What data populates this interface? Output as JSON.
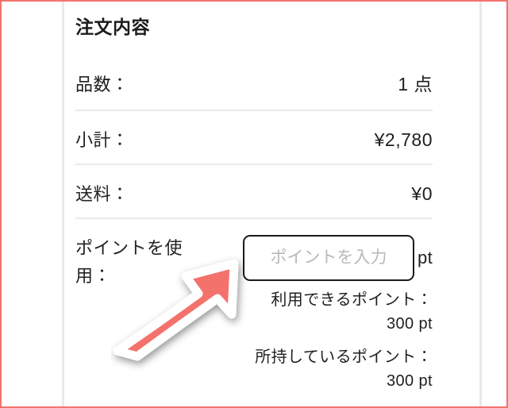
{
  "panel": {
    "title": "注文内容",
    "rows": [
      {
        "label": "品数：",
        "value": "1 点"
      },
      {
        "label": "小計：",
        "value": "¥2,780"
      },
      {
        "label": "送料：",
        "value": "¥0"
      }
    ],
    "points": {
      "label": "ポイントを使用：",
      "input_placeholder": "ポイントを入力",
      "input_value": "",
      "unit_suffix": "pt",
      "available_label": "利用できるポイント：",
      "available_value": "300 pt",
      "owned_label": "所持しているポイント：",
      "owned_value": "300 pt"
    }
  },
  "annotation": {
    "arrow_name": "arrow-pointing-to-points-input",
    "arrow_fill": "#f4726c",
    "arrow_outline": "#ffffff"
  },
  "colors": {
    "highlight_frame": "#f4736d",
    "divider": "#eaeaea",
    "gutter_rule": "#e9e9e9",
    "text_primary": "#1e1e1e",
    "placeholder": "#b9b9b9"
  }
}
